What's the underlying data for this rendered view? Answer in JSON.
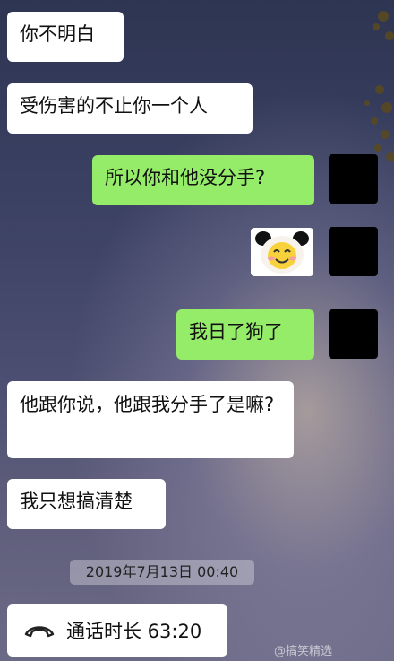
{
  "messages": [
    {
      "side": "left",
      "text": "你不明白"
    },
    {
      "side": "left",
      "text": "受伤害的不止你一个人"
    },
    {
      "side": "right",
      "text": "所以你和他没分手?"
    },
    {
      "side": "right",
      "type": "sticker",
      "sticker": "smiling-panda-sticker"
    },
    {
      "side": "right",
      "text": "我日了狗了"
    },
    {
      "side": "left",
      "text": "他跟你说，他跟我分手了是嘛?"
    },
    {
      "side": "left",
      "text": "我只想搞清楚"
    }
  ],
  "timestamp": "2019年7月13日 00:40",
  "call": {
    "icon": "phone-hangup-icon",
    "text": "通话时长 63:20"
  },
  "watermark": "@搞笑精选"
}
